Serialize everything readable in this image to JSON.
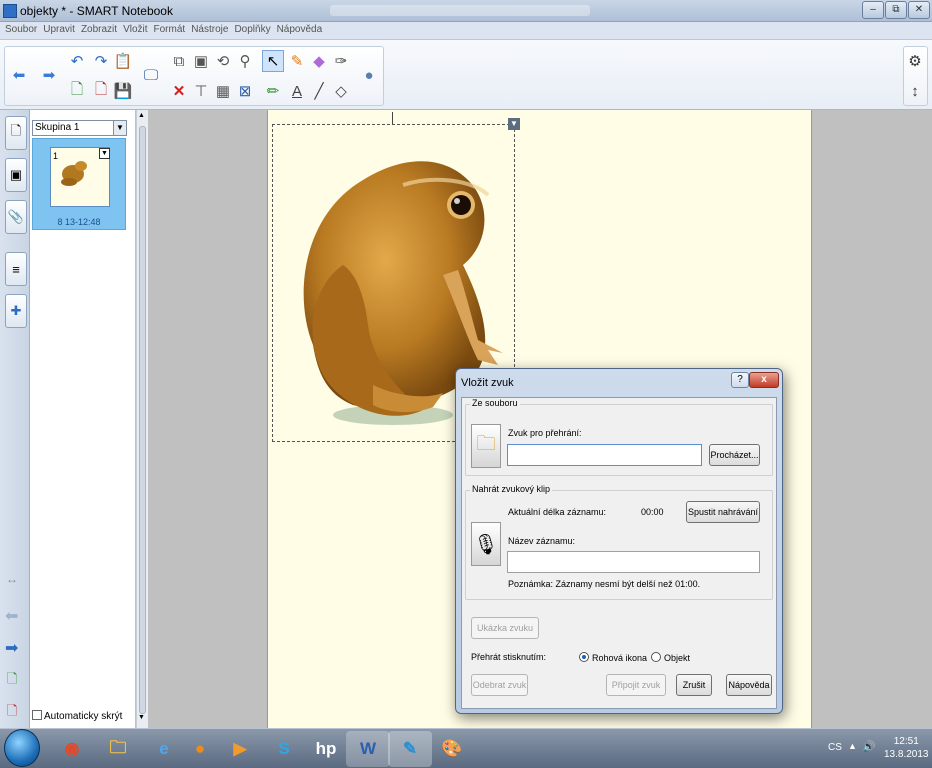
{
  "window": {
    "title": "objekty * - SMART Notebook",
    "minimize": "–",
    "maximize": "⧉",
    "close": "✕"
  },
  "menu": [
    "Soubor",
    "Upravit",
    "Zobrazit",
    "Vložit",
    "Formát",
    "Nástroje",
    "Doplňky",
    "Nápověda"
  ],
  "toolbar_icons": {
    "back": "back-arrow-icon",
    "forward": "forward-arrow-icon",
    "undo": "undo-icon",
    "redo": "redo-icon",
    "paste": "paste-icon",
    "insert_page": "insert-page-icon",
    "delete_page": "delete-page-icon",
    "save": "save-icon",
    "screen": "screen-display-icon",
    "clone": "clone-icon",
    "screen_capture": "screen-capture-icon",
    "delete": "delete-icon",
    "screen_shade": "screen-shade-icon",
    "table": "table-icon",
    "fullscreen": "fullscreen-icon",
    "rotate": "rotate-icon",
    "doc_camera": "document-camera-icon",
    "select": "select-arrow-icon",
    "pens": "pens-icon",
    "creative_pens": "creative-pens-icon",
    "eraser": "eraser-icon",
    "text": "text-icon",
    "lines": "lines-icon",
    "shapes": "shapes-icon",
    "fill": "fill-icon",
    "magic_pen": "magic-pen-icon",
    "properties": "properties-icon",
    "settings": "settings-gear-icon",
    "toolbar_move": "toolbar-move-icon"
  },
  "sidebar": {
    "group_select": "Skupina 1",
    "page_number": "1",
    "page_label": "8 13-12:48",
    "autohide_label": "Automaticky skrýt"
  },
  "dialog": {
    "title": "Vložit zvuk",
    "help": "?",
    "close": "x",
    "from_file_legend": "Ze souboru",
    "sound_for_playback_label": "Zvuk pro přehrání:",
    "sound_for_playback_value": "",
    "browse_button": "Procházet...",
    "record_legend": "Nahrát zvukový klip",
    "current_length_label": "Aktuální délka záznamu:",
    "current_length_value": "00:00",
    "start_record_button": "Spustit nahrávání",
    "record_name_label": "Název záznamu:",
    "record_name_value": "",
    "note": "Poznámka: Záznamy nesmí být delší než 01:00.",
    "sample_button": "Ukázka zvuku",
    "play_on_press_label": "Přehrát stisknutím:",
    "radio_corner_icon": "Rohová ikona",
    "radio_object": "Objekt",
    "selected_radio": "corner_icon",
    "remove_button": "Odebrat zvuk",
    "attach_button": "Připojit zvuk",
    "cancel_button": "Zrušit",
    "help_button": "Nápověda"
  },
  "taskbar": {
    "apps": [
      "chrome-icon",
      "explorer-folder-icon",
      "internet-explorer-icon",
      "firefox-icon",
      "media-player-icon",
      "skype-icon",
      "hp-icon",
      "word-icon",
      "notebook-icon",
      "paint-icon"
    ],
    "language": "CS",
    "time": "12:51",
    "date": "13.8.2013"
  },
  "colors": {
    "page": "#fffde5",
    "workspace": "#c0c0c0",
    "thumbnail_selected": "#7fc4f0",
    "close_red": "#c23a24"
  }
}
